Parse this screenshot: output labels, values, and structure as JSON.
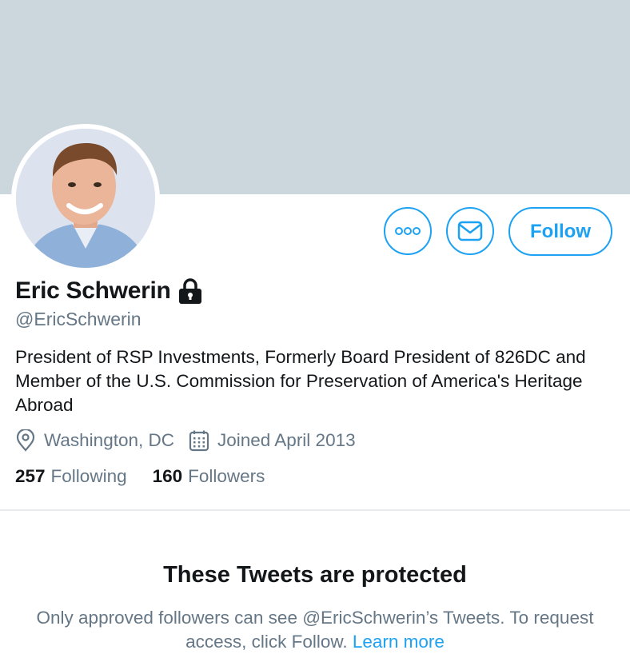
{
  "profile": {
    "name": "Eric Schwerin",
    "handle": "@EricSchwerin",
    "bio": "President of RSP Investments, Formerly Board President of 826DC and Member of the U.S. Commission for Preservation of America's Heritage Abroad",
    "location": "Washington, DC",
    "joined": "Joined April 2013",
    "locked_icon": "lock-icon"
  },
  "actions": {
    "more_icon": "more-options-icon",
    "message_icon": "envelope-icon",
    "follow_label": "Follow"
  },
  "stats": {
    "following_count": "257",
    "following_label": "Following",
    "followers_count": "160",
    "followers_label": "Followers"
  },
  "protected": {
    "title": "These Tweets are protected",
    "text": "Only approved followers can see @EricSchwerin’s Tweets. To request access, click Follow. ",
    "learn_more": "Learn more"
  },
  "colors": {
    "accent": "#1da1f2",
    "banner": "#ccd6dd",
    "secondary_text": "#657786",
    "primary_text": "#14171a"
  }
}
